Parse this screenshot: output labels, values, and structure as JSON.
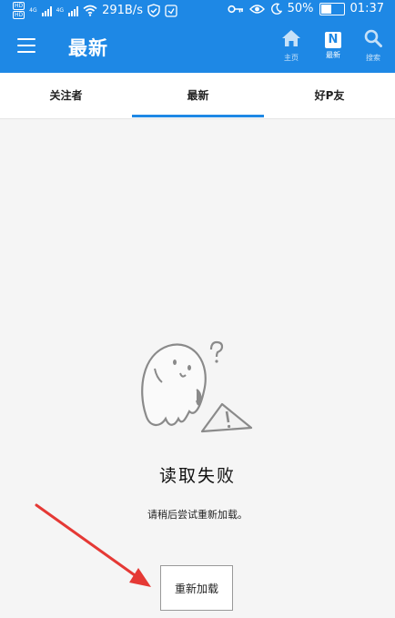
{
  "status_bar": {
    "hd1": "HD",
    "hd2": "HD",
    "net1": "4G",
    "net2": "4G",
    "speed": "291B/s",
    "battery": "50%",
    "battery_level": 0.5,
    "time": "01:37"
  },
  "app_bar": {
    "title": "最新",
    "actions": [
      {
        "label": "主页",
        "icon": "home-icon"
      },
      {
        "label": "最新",
        "icon": "n-icon",
        "badge": "N"
      },
      {
        "label": "搜索",
        "icon": "search-icon"
      }
    ]
  },
  "tabs": [
    {
      "label": "关注者"
    },
    {
      "label": "最新",
      "active": true
    },
    {
      "label": "好P友"
    }
  ],
  "empty_state": {
    "title": "读取失败",
    "message": "请稍后尝试重新加载。",
    "button": "重新加载"
  },
  "colors": {
    "primary": "#1e88e5",
    "background": "#f5f5f5",
    "arrow": "#e53935"
  }
}
